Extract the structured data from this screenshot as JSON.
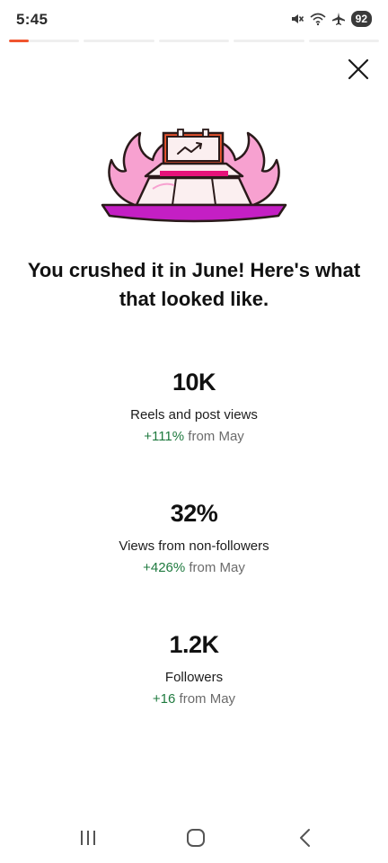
{
  "status_bar": {
    "time": "5:45",
    "battery": "92",
    "icons": [
      "mute-icon",
      "wifi-icon",
      "airplane-icon",
      "battery-icon"
    ]
  },
  "story_progress": {
    "segments": 5,
    "current_segment": 1,
    "current_progress": 0.28,
    "accent_color": "#f0552f"
  },
  "hero_illustration": "hot-stage-illustration",
  "headline": "You crushed it in June! Here's what that looked like.",
  "stats": [
    {
      "value": "10K",
      "label": "Reels and post views",
      "change": "+111%",
      "change_suffix": "from May"
    },
    {
      "value": "32%",
      "label": "Views from non-followers",
      "change": "+426%",
      "change_suffix": "from May"
    },
    {
      "value": "1.2K",
      "label": "Followers",
      "change": "+16",
      "change_suffix": "from May"
    }
  ],
  "colors": {
    "positive_change": "#1f7a3f",
    "muted_text": "#6b6b6b",
    "flame_pink": "#f7a1d0",
    "stage_magenta": "#c41fc4"
  },
  "nav_bar": {
    "icons": [
      "recent-apps-icon",
      "home-icon",
      "back-icon"
    ]
  }
}
